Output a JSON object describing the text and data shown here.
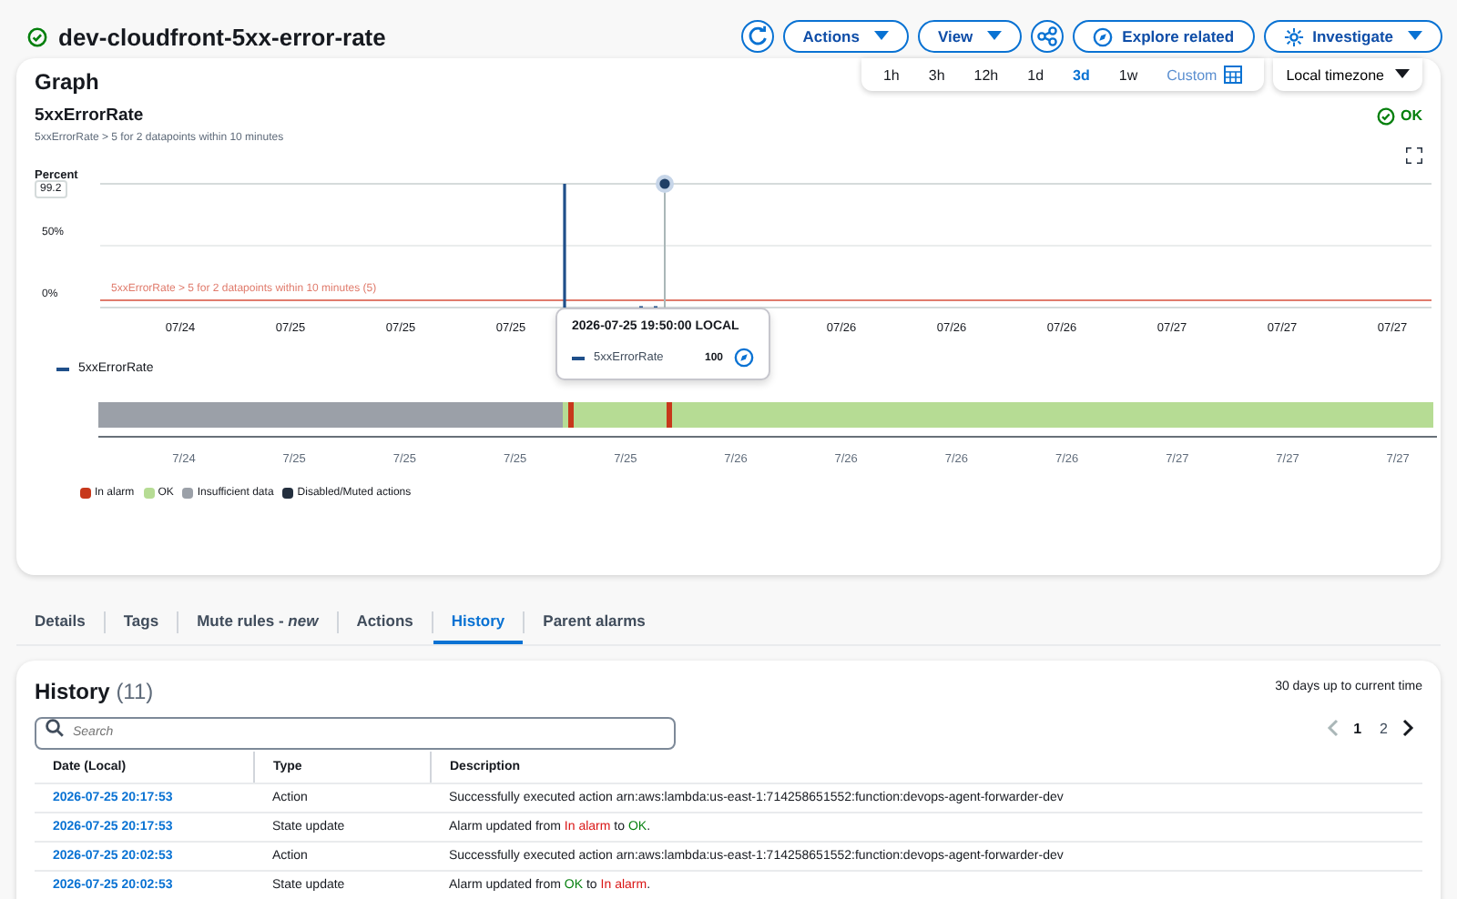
{
  "header": {
    "title": "dev-cloudfront-5xx-error-rate",
    "ok": true,
    "buttons": [
      {
        "kind": "refresh"
      },
      {
        "kind": "menu",
        "label": "Actions"
      },
      {
        "kind": "menu",
        "label": "View"
      },
      {
        "kind": "share"
      },
      {
        "kind": "explore",
        "label": "Explore related"
      },
      {
        "kind": "investigate",
        "label": "Investigate"
      }
    ]
  },
  "graph": {
    "title": "Graph",
    "ranges": [
      {
        "label": "1h",
        "selected": false
      },
      {
        "label": "3h",
        "selected": false
      },
      {
        "label": "12h",
        "selected": false
      },
      {
        "label": "1d",
        "selected": false
      },
      {
        "label": "3d",
        "selected": true
      },
      {
        "label": "1w",
        "selected": false
      }
    ],
    "custom": "Custom",
    "timezone": "Local timezone",
    "metric": "5xxErrorRate",
    "condition": "5xxErrorRate > 5 for 2 datapoints within 10 minutes",
    "state": "OK",
    "y_label": "Percent",
    "hover_value": "99.2",
    "y_ticks": [
      "50%",
      "0%"
    ],
    "threshold_label": "5xxErrorRate > 5 for 2 datapoints within 10 minutes (5)",
    "x_labels": [
      "07/24",
      "07/25",
      "07/25",
      "07/25",
      "07/26",
      "07/26",
      "07/26",
      "07/27",
      "07/27",
      "07/27"
    ],
    "legend": "5xxErrorRate",
    "tooltip": {
      "time": "2026-07-25 19:50:00 LOCAL",
      "metric": "5xxErrorRate",
      "value": "100"
    },
    "status_ticks": [
      "7/24",
      "7/25",
      "7/25",
      "7/25",
      "7/25",
      "7/26",
      "7/26",
      "7/26",
      "7/26",
      "7/27",
      "7/27",
      "7/27"
    ],
    "status_legend": [
      {
        "label": "In alarm",
        "color": "#c7381b"
      },
      {
        "label": "OK",
        "color": "#b6dc94"
      },
      {
        "label": "Insufficient data",
        "color": "#9ba0a8"
      },
      {
        "label": "Disabled/Muted actions",
        "color": "#232f3e"
      }
    ]
  },
  "tabs": [
    {
      "label": "Details",
      "selected": false
    },
    {
      "label": "Tags",
      "selected": false
    },
    {
      "label": "Mute rules - ",
      "em": "new",
      "selected": false
    },
    {
      "label": "Actions",
      "selected": false
    },
    {
      "label": "History",
      "selected": true
    },
    {
      "label": "Parent alarms",
      "selected": false
    }
  ],
  "history": {
    "title": "History",
    "count": "(11)",
    "range": "30 days up to current time",
    "search_placeholder": "Search",
    "pages": [
      {
        "label": "1",
        "selected": true
      },
      {
        "label": "2",
        "selected": false
      }
    ],
    "columns": [
      "Date (Local)",
      "Type",
      "Description"
    ],
    "rows": [
      {
        "date": "2026-07-25 20:17:53",
        "type": "Action",
        "description": [
          {
            "text": "Successfully executed action arn:aws:lambda:us-east-1:714258651552:function:devops-agent-forwarder-dev"
          }
        ]
      },
      {
        "date": "2026-07-25 20:17:53",
        "type": "State update",
        "description": [
          {
            "text": "Alarm updated from "
          },
          {
            "text": "In alarm",
            "alarm": true
          },
          {
            "text": " to "
          },
          {
            "text": "OK",
            "ok": true
          },
          {
            "text": "."
          }
        ]
      },
      {
        "date": "2026-07-25 20:02:53",
        "type": "Action",
        "description": [
          {
            "text": "Successfully executed action arn:aws:lambda:us-east-1:714258651552:function:devops-agent-forwarder-dev"
          }
        ]
      },
      {
        "date": "2026-07-25 20:02:53",
        "type": "State update",
        "description": [
          {
            "text": "Alarm updated from "
          },
          {
            "text": "OK",
            "ok": true
          },
          {
            "text": " to "
          },
          {
            "text": "In alarm",
            "alarm": true
          },
          {
            "text": "."
          }
        ]
      }
    ]
  }
}
